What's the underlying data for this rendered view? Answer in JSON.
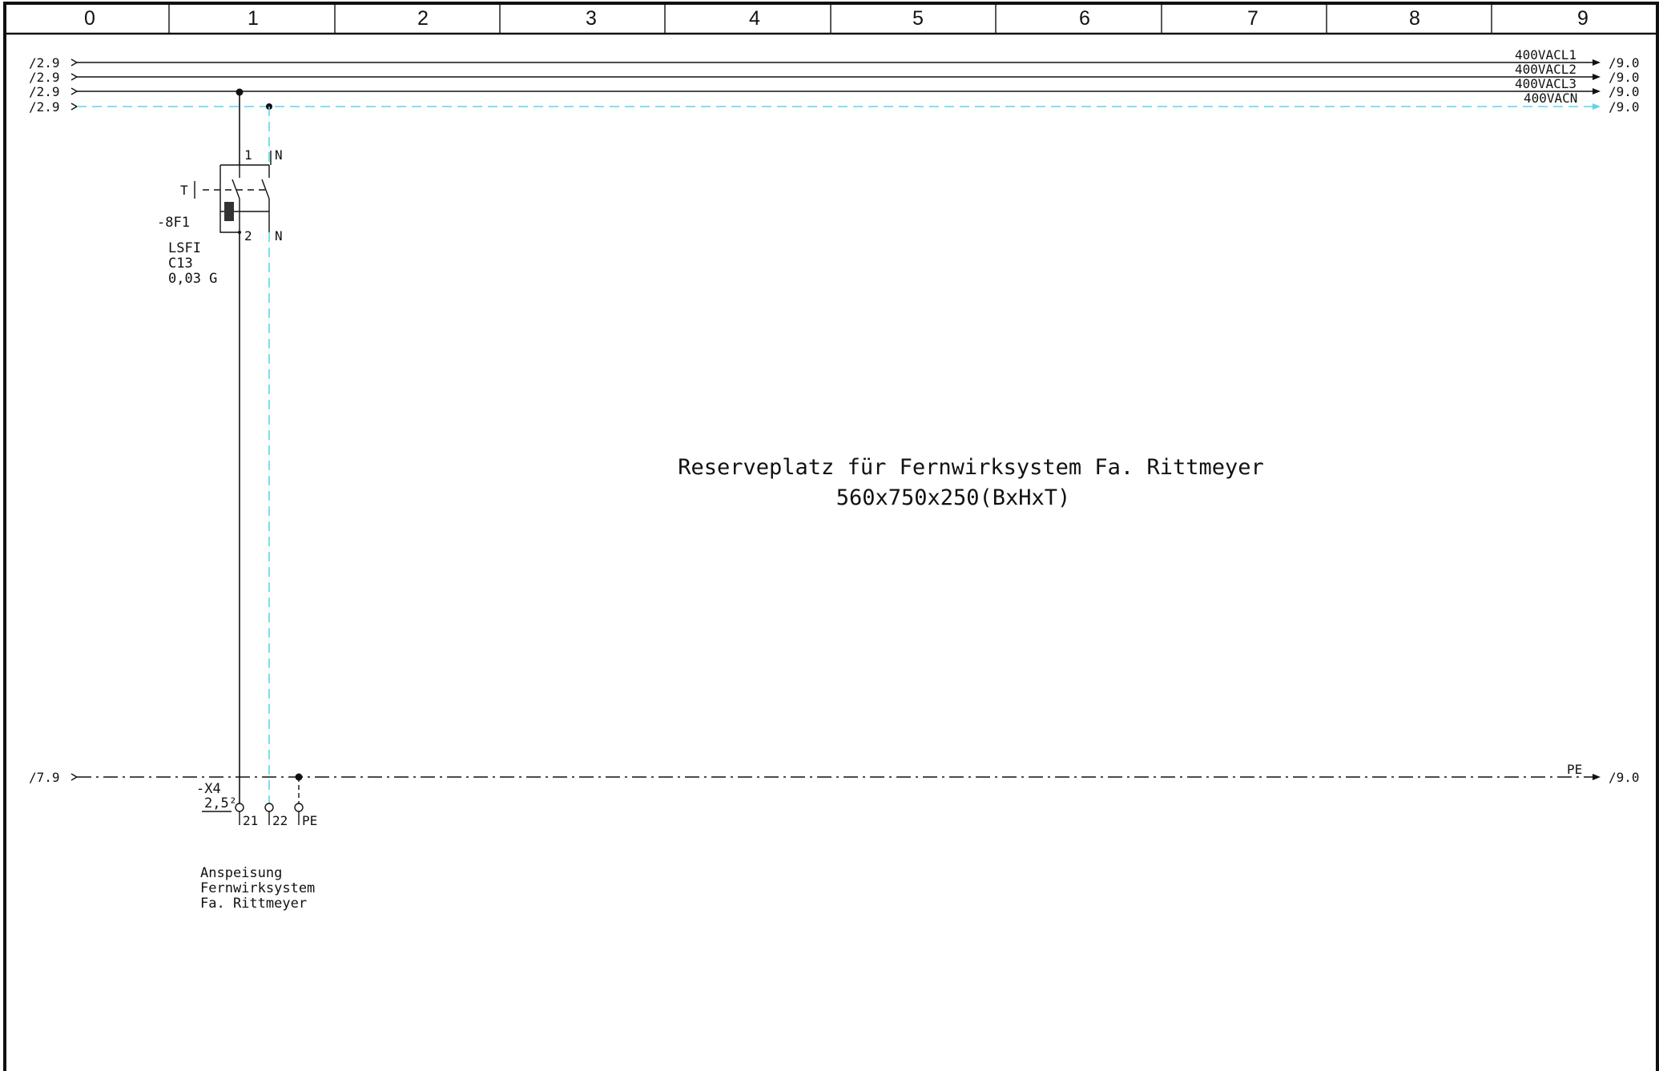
{
  "grid": {
    "columns": [
      "0",
      "1",
      "2",
      "3",
      "4",
      "5",
      "6",
      "7",
      "8",
      "9"
    ]
  },
  "busbars": [
    {
      "from_ref": "/2.9",
      "signal": "400VACL1",
      "to_ref": "/9.0"
    },
    {
      "from_ref": "/2.9",
      "signal": "400VACL2",
      "to_ref": "/9.0"
    },
    {
      "from_ref": "/2.9",
      "signal": "400VACL3",
      "to_ref": "/9.0"
    },
    {
      "from_ref": "/2.9",
      "signal": "400VACN",
      "to_ref": "/9.0"
    }
  ],
  "pe_bus": {
    "from_ref": "/7.9",
    "signal": "PE",
    "to_ref": "/9.0"
  },
  "breaker": {
    "designation": "-8F1",
    "type": "LSFI",
    "rating": "C13",
    "sensitivity": "0,03 G",
    "test_label": "T",
    "pin_top_1": "1",
    "pin_top_n": "N",
    "pin_bottom_2": "2",
    "pin_bottom_n": "N"
  },
  "terminal": {
    "designation": "-X4",
    "cross_section": "2,5²",
    "pins": [
      "21",
      "22",
      "PE"
    ]
  },
  "feed_note": [
    "Anspeisung",
    "Fernwirksystem",
    "Fa. Rittmeyer"
  ],
  "reserve_note": {
    "line1": "Reserveplatz für Fernwirksystem Fa. Rittmeyer",
    "line2": "560x750x250(BxHxT)"
  },
  "colors": {
    "neutral_wire": "#5ad7e6",
    "line": "#111111"
  }
}
